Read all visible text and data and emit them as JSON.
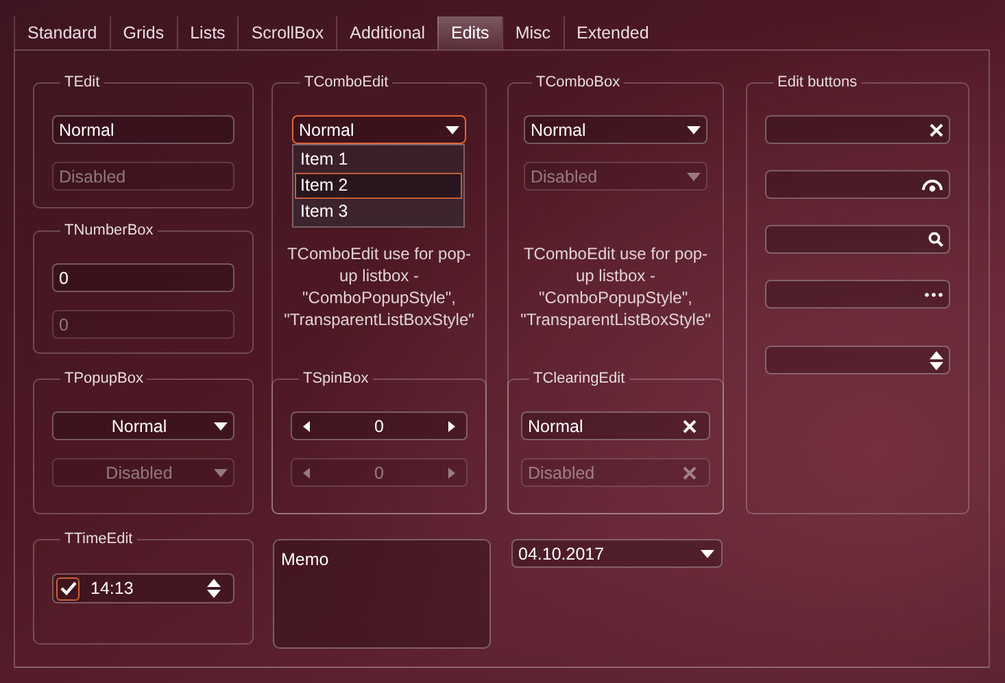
{
  "tabs": [
    {
      "label": "Standard",
      "selected": false
    },
    {
      "label": "Grids",
      "selected": false
    },
    {
      "label": "Lists",
      "selected": false
    },
    {
      "label": "ScrollBox",
      "selected": false
    },
    {
      "label": "Additional",
      "selected": false
    },
    {
      "label": "Edits",
      "selected": true
    },
    {
      "label": "Misc",
      "selected": false
    },
    {
      "label": "Extended",
      "selected": false
    }
  ],
  "tedit": {
    "title": "TEdit",
    "fields": [
      {
        "value": "Normal",
        "disabled": false
      },
      {
        "value": "Disabled",
        "disabled": true
      }
    ]
  },
  "number_box": {
    "title": "TNumberBox",
    "fields": [
      {
        "value": "0",
        "disabled": false
      },
      {
        "value": "0",
        "disabled": true
      }
    ]
  },
  "combo_edit": {
    "title": "TComboEdit",
    "value": "Normal",
    "focused": true,
    "dropdown": [
      {
        "label": "Item 1",
        "selected": false
      },
      {
        "label": "Item 2",
        "selected": true
      },
      {
        "label": "Item 3",
        "selected": false
      }
    ],
    "note": "TComboEdit use for pop-up listbox - \"ComboPopupStyle\", \"TransparentListBoxStyle\""
  },
  "combo_box": {
    "title": "TComboBox",
    "fields": [
      {
        "value": "Normal",
        "disabled": false
      },
      {
        "value": "Disabled",
        "disabled": true
      }
    ],
    "note": "TComboEdit use for pop-up listbox - \"ComboPopupStyle\", \"TransparentListBoxStyle\""
  },
  "popup_box": {
    "title": "TPopupBox",
    "fields": [
      {
        "value": "Normal",
        "disabled": false
      },
      {
        "value": "Disabled",
        "disabled": true
      }
    ]
  },
  "spin_box": {
    "title": "TSpinBox",
    "fields": [
      {
        "value": "0",
        "disabled": false
      },
      {
        "value": "0",
        "disabled": true
      }
    ]
  },
  "clearing_edit": {
    "title": "TClearingEdit",
    "fields": [
      {
        "value": "Normal",
        "disabled": false
      },
      {
        "value": "Disabled",
        "disabled": true
      }
    ]
  },
  "edit_buttons": {
    "title": "Edit buttons",
    "fields": [
      {
        "kind": "clear"
      },
      {
        "kind": "password"
      },
      {
        "kind": "search"
      },
      {
        "kind": "ellipsis"
      },
      {
        "kind": "spin"
      }
    ]
  },
  "time_edit": {
    "title": "TTimeEdit",
    "checked": true,
    "value": "14:13"
  },
  "memo": {
    "text": "Memo"
  },
  "date_edit": {
    "value": "04.10.2017"
  }
}
